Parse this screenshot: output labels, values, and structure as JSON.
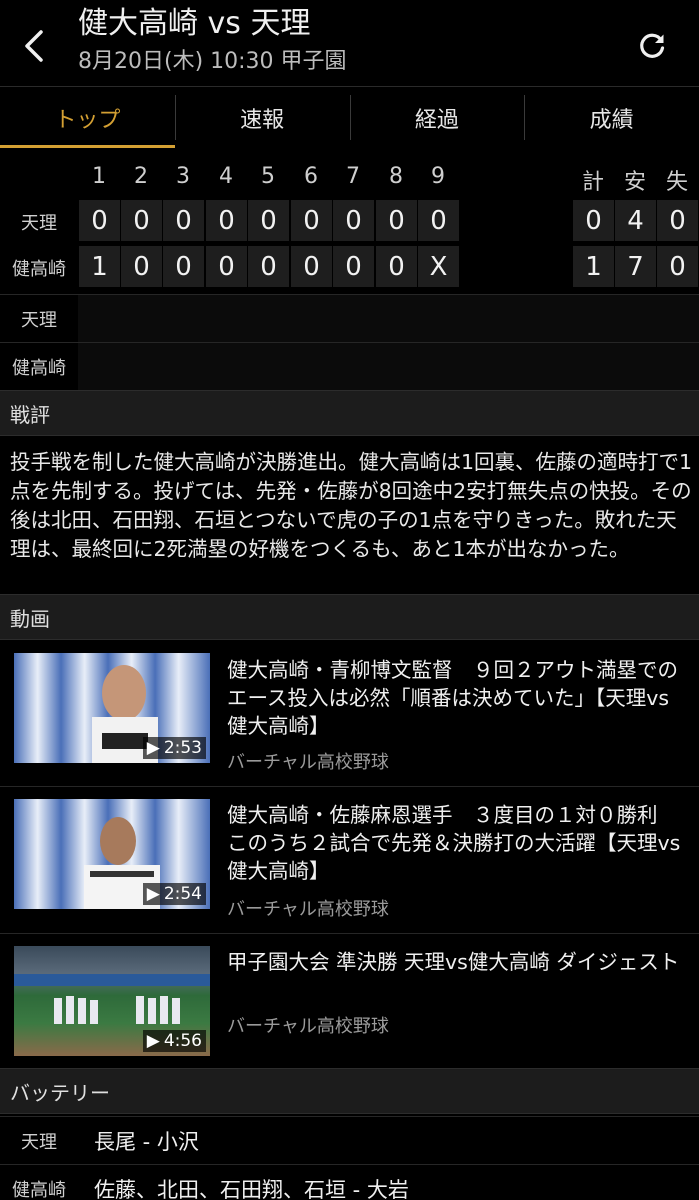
{
  "header": {
    "title": "健大高崎 vs 天理",
    "subtitle": "8月20日(木) 10:30 甲子園",
    "back_icon": "chevron-left-icon",
    "refresh_icon": "refresh-icon"
  },
  "tabs": [
    {
      "label": "トップ",
      "active": true
    },
    {
      "label": "速報",
      "active": false
    },
    {
      "label": "経過",
      "active": false
    },
    {
      "label": "成績",
      "active": false
    }
  ],
  "scoreboard": {
    "innings": [
      "1",
      "2",
      "3",
      "4",
      "5",
      "6",
      "7",
      "8",
      "9"
    ],
    "totals_headers": [
      "計",
      "安",
      "失"
    ],
    "teams": [
      {
        "name": "天理",
        "innings": [
          "0",
          "0",
          "0",
          "0",
          "0",
          "0",
          "0",
          "0",
          "0"
        ],
        "totals": [
          "0",
          "4",
          "0"
        ]
      },
      {
        "name": "健高崎",
        "innings": [
          "1",
          "0",
          "0",
          "0",
          "0",
          "0",
          "0",
          "0",
          "X"
        ],
        "totals": [
          "1",
          "7",
          "0"
        ]
      }
    ]
  },
  "pitchers": [
    {
      "team": "天理",
      "value": ""
    },
    {
      "team": "健高崎",
      "value": ""
    }
  ],
  "review": {
    "header": "戦評",
    "text": "投手戦を制した健大高崎が決勝進出。健大高崎は1回裏、佐藤の適時打で1点を先制する。投げては、先発・佐藤が8回途中2安打無失点の快投。その後は北田、石田翔、石垣とつないで虎の子の1点を守りきった。敗れた天理は、最終回に2死満塁の好機をつくるも、あと1本が出なかった。"
  },
  "videos": {
    "header": "動画",
    "items": [
      {
        "title": "健大高崎・青柳博文監督　９回２アウト満塁でのエース投入は必然「順番は決めていた」【天理vs健大高崎】",
        "source": "バーチャル高校野球",
        "duration": "2:53"
      },
      {
        "title": "健大高崎・佐藤麻恩選手　３度目の１対０勝利　このうち２試合で先発＆決勝打の大活躍【天理vs健大高崎】",
        "source": "バーチャル高校野球",
        "duration": "2:54"
      },
      {
        "title": "甲子園大会 準決勝 天理vs健大高崎 ダイジェスト",
        "source": "バーチャル高校野球",
        "duration": "4:56"
      }
    ]
  },
  "battery": {
    "header": "バッテリー",
    "rows": [
      {
        "team": "天理",
        "value": "長尾 - 小沢"
      },
      {
        "team": "健高崎",
        "value": "佐藤、北田、石田翔、石垣 - 大岩"
      }
    ]
  },
  "colors": {
    "accent": "#d4a033",
    "background": "#000000",
    "cell": "#1e1e1e",
    "section": "#1c1c1c"
  }
}
